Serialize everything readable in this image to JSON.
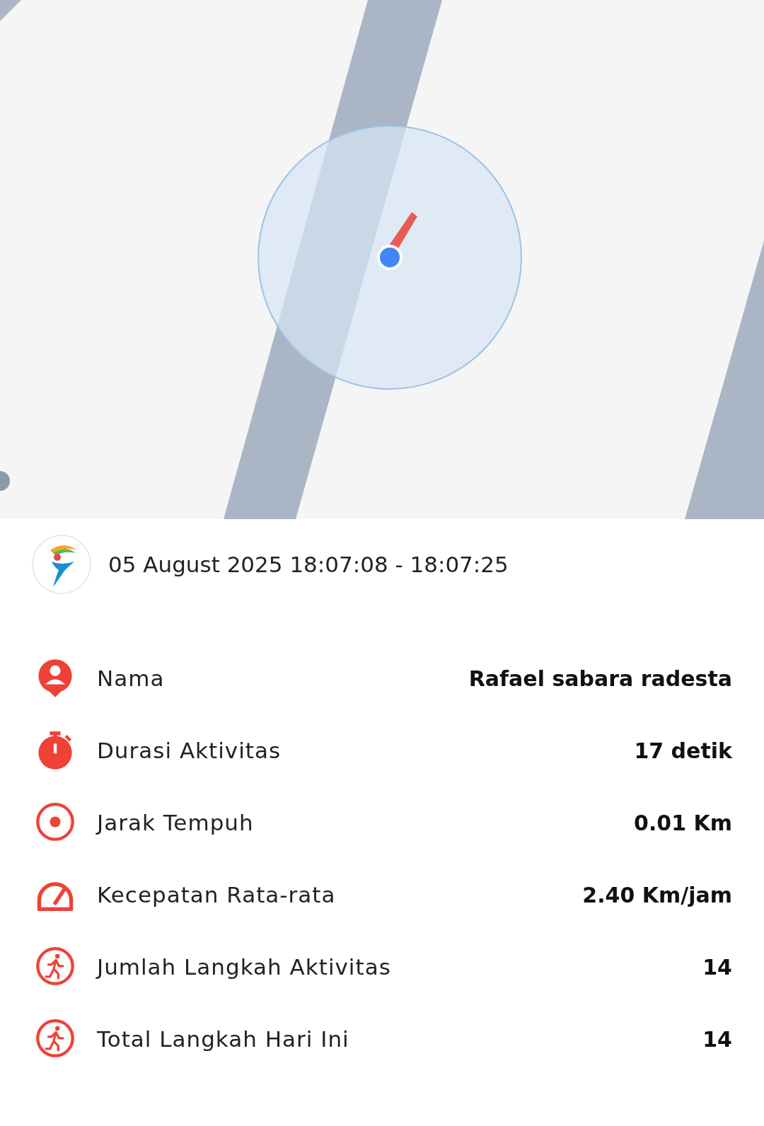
{
  "session": {
    "time_range": "05 August 2025 18:07:08 - 18:07:25"
  },
  "stats": [
    {
      "kind": "person",
      "label": "Nama",
      "value": "Rafael sabara radesta"
    },
    {
      "kind": "timer",
      "label": "Durasi Aktivitas",
      "value": "17 detik"
    },
    {
      "kind": "target",
      "label": "Jarak Tempuh",
      "value": "0.01 Km"
    },
    {
      "kind": "speed",
      "label": "Kecepatan Rata-rata",
      "value": "2.40 Km/jam"
    },
    {
      "kind": "walk",
      "label": "Jumlah Langkah Aktivitas",
      "value": "14"
    },
    {
      "kind": "walk",
      "label": "Total Langkah Hari Ini",
      "value": "14"
    }
  ]
}
